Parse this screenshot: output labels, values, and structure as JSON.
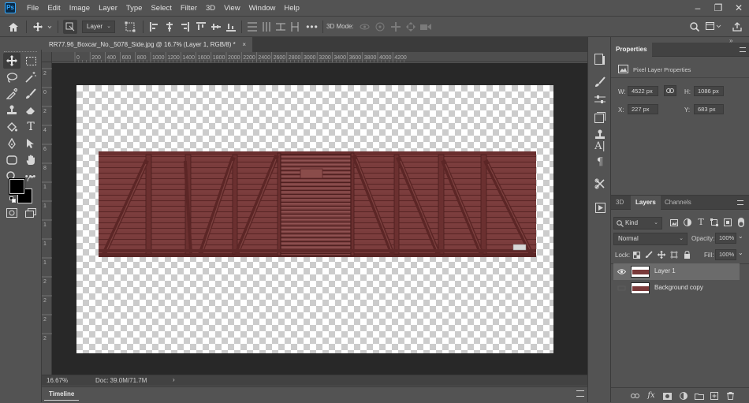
{
  "app": {
    "logo_text": "Ps"
  },
  "menu": [
    "File",
    "Edit",
    "Image",
    "Layer",
    "Type",
    "Select",
    "Filter",
    "3D",
    "View",
    "Window",
    "Help"
  ],
  "window_controls": {
    "minimize": "–",
    "restore": "❐",
    "close": "✕"
  },
  "options_bar": {
    "auto_select_target": "Layer",
    "mode_3d_label": "3D Mode:"
  },
  "document": {
    "tab_title": "RR77.96_Boxcar_No._5078_Side.jpg @ 16.7% (Layer 1, RGB/8) *",
    "close_glyph": "×"
  },
  "rulers": {
    "horizontal": [
      "0",
      "200",
      "400",
      "600",
      "800",
      "1000",
      "1200",
      "1400",
      "1600",
      "1800",
      "2000",
      "2200",
      "2400",
      "2600",
      "2800",
      "3000",
      "3200",
      "3400",
      "3600",
      "3800",
      "4000",
      "4200"
    ],
    "vertical": [
      "2",
      "0",
      "2",
      "4",
      "6",
      "8",
      "1",
      "1",
      "1",
      "1",
      "1",
      "2",
      "2",
      "2",
      "2"
    ]
  },
  "status": {
    "zoom": "16.67%",
    "doc_info": "Doc: 39.0M/71.7M"
  },
  "timeline": {
    "tab": "Timeline"
  },
  "properties": {
    "tab": "Properties",
    "subtitle": "Pixel Layer Properties",
    "w_label": "W:",
    "w_value": "4522 px",
    "h_label": "H:",
    "h_value": "1086 px",
    "x_label": "X:",
    "x_value": "227 px",
    "y_label": "Y:",
    "y_value": "683 px"
  },
  "layers_panel": {
    "tabs": [
      "3D",
      "Layers",
      "Channels"
    ],
    "filter_kind": "Kind",
    "blend_mode": "Normal",
    "opacity_label": "Opacity:",
    "opacity": "100%",
    "lock_label": "Lock:",
    "fill_label": "Fill:",
    "fill": "100%",
    "layers": [
      {
        "name": "Layer 1",
        "visible": true,
        "selected": true
      },
      {
        "name": "Background copy",
        "visible": false,
        "selected": false
      }
    ]
  },
  "colors": {
    "ui_bg": "#535353",
    "pasteboard": "#282828",
    "selection": "#6b6b6b",
    "boxcar_red": "#7a3a3a"
  }
}
